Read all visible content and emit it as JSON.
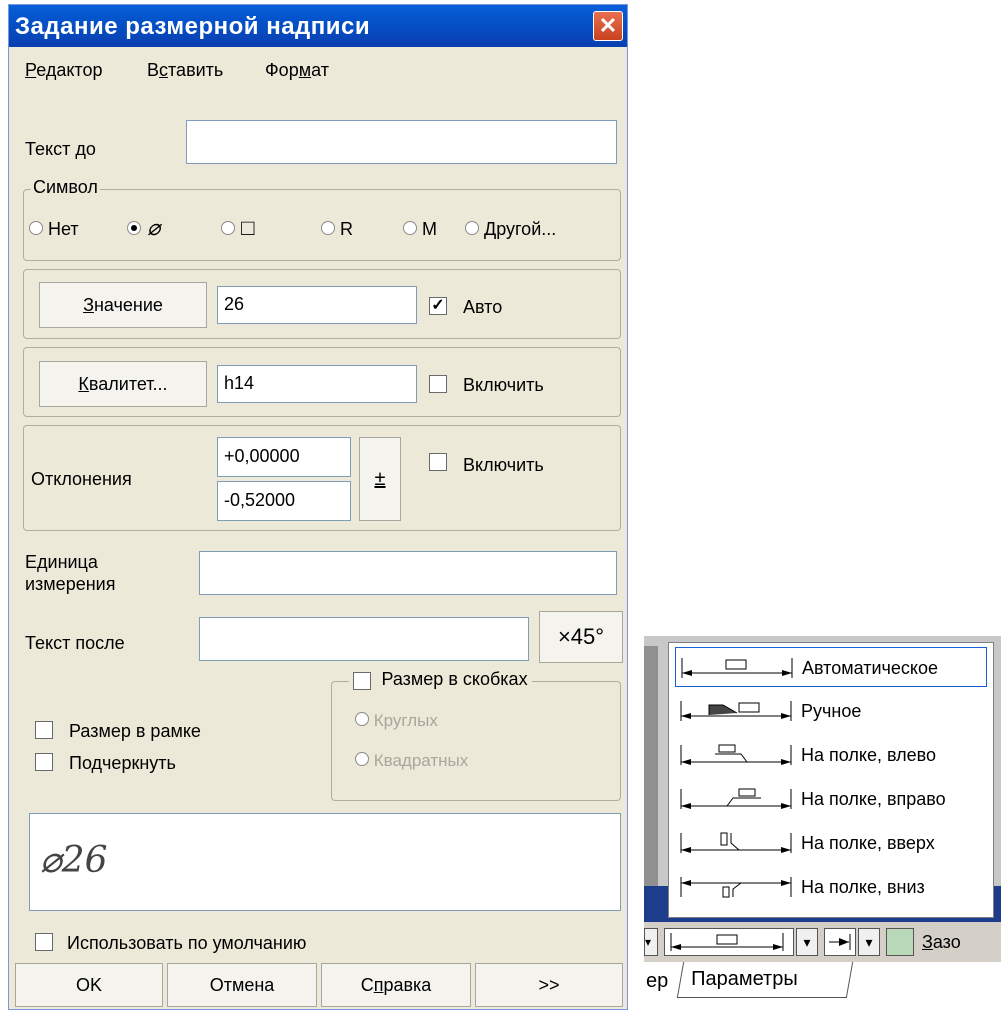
{
  "dialog": {
    "title": "Задание размерной надписи",
    "menu": [
      {
        "pre": "",
        "key": "Р",
        "post": "едактор"
      },
      {
        "pre": "В",
        "key": "с",
        "post": "тавить"
      },
      {
        "pre": "Фор",
        "key": "м",
        "post": "ат"
      }
    ],
    "text_before_label": "Текст до",
    "text_before_value": "",
    "symbol": {
      "group_title": "Символ",
      "options": [
        "Нет",
        "⌀",
        "□",
        "R",
        "M",
        "Другой..."
      ],
      "selected": 1
    },
    "value": {
      "btn_key": "З",
      "btn_rest": "начение",
      "field": "26",
      "auto_label": "Авто",
      "auto_checked": true
    },
    "quality": {
      "btn_key": "К",
      "btn_rest": "валитет...",
      "field": "h14",
      "enable_label": "Включить",
      "enable_checked": false
    },
    "deviations": {
      "label": "Отклонения",
      "upper": "+0,00000",
      "lower": "-0,52000",
      "pm_symbol": "±",
      "enable_label": "Включить"
    },
    "unit": {
      "label_line1": "Единица",
      "label_line2": "измерения",
      "value": ""
    },
    "text_after": {
      "label": "Текст после",
      "value": "",
      "btn": "×45°"
    },
    "framed_label": "Размер в рамке",
    "underline_label": "Подчеркнуть",
    "brackets": {
      "label": "Размер в скобках",
      "round": "Круглых",
      "square": "Квадратных"
    },
    "preview_text": "⌀26",
    "use_default_label": "Использовать по умолчанию",
    "buttons": {
      "ok": "OK",
      "cancel": "Отмена",
      "help_pre": "С",
      "help_key": "п",
      "help_post": "равка",
      "more": ">>"
    }
  },
  "placement_menu": {
    "items": [
      "Автоматическое",
      "Ручное",
      "На полке, влево",
      "На полке, вправо",
      "На полке, вверх",
      "На полке, вниз"
    ],
    "selected": 0
  },
  "toolbar": {
    "gap_pre": "",
    "gap_key": "З",
    "gap_post": "азо"
  },
  "tabs": {
    "prev": "ер",
    "active": "Параметры"
  }
}
